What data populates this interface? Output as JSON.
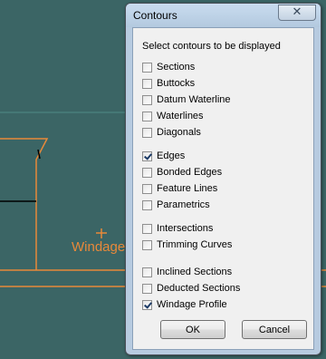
{
  "background": {
    "canvas_color": "#3b6565",
    "geometry_color": "#e8893a",
    "windage_label": "Windage"
  },
  "dialog": {
    "title": "Contours",
    "close_symbol": "✕",
    "prompt": "Select contours to be displayed",
    "groups": [
      [
        {
          "label": "Sections",
          "checked": false
        },
        {
          "label": "Buttocks",
          "checked": false
        },
        {
          "label": "Datum Waterline",
          "checked": false
        },
        {
          "label": "Waterlines",
          "checked": false
        },
        {
          "label": "Diagonals",
          "checked": false
        }
      ],
      [
        {
          "label": "Edges",
          "checked": true
        },
        {
          "label": "Bonded Edges",
          "checked": false
        },
        {
          "label": "Feature Lines",
          "checked": false
        },
        {
          "label": "Parametrics",
          "checked": false
        }
      ],
      [
        {
          "label": "Intersections",
          "checked": false
        },
        {
          "label": "Trimming Curves",
          "checked": false
        }
      ],
      [
        {
          "label": "Inclined Sections",
          "checked": false
        },
        {
          "label": "Deducted Sections",
          "checked": false
        },
        {
          "label": "Windage Profile",
          "checked": true
        }
      ]
    ],
    "ok_label": "OK",
    "cancel_label": "Cancel"
  }
}
